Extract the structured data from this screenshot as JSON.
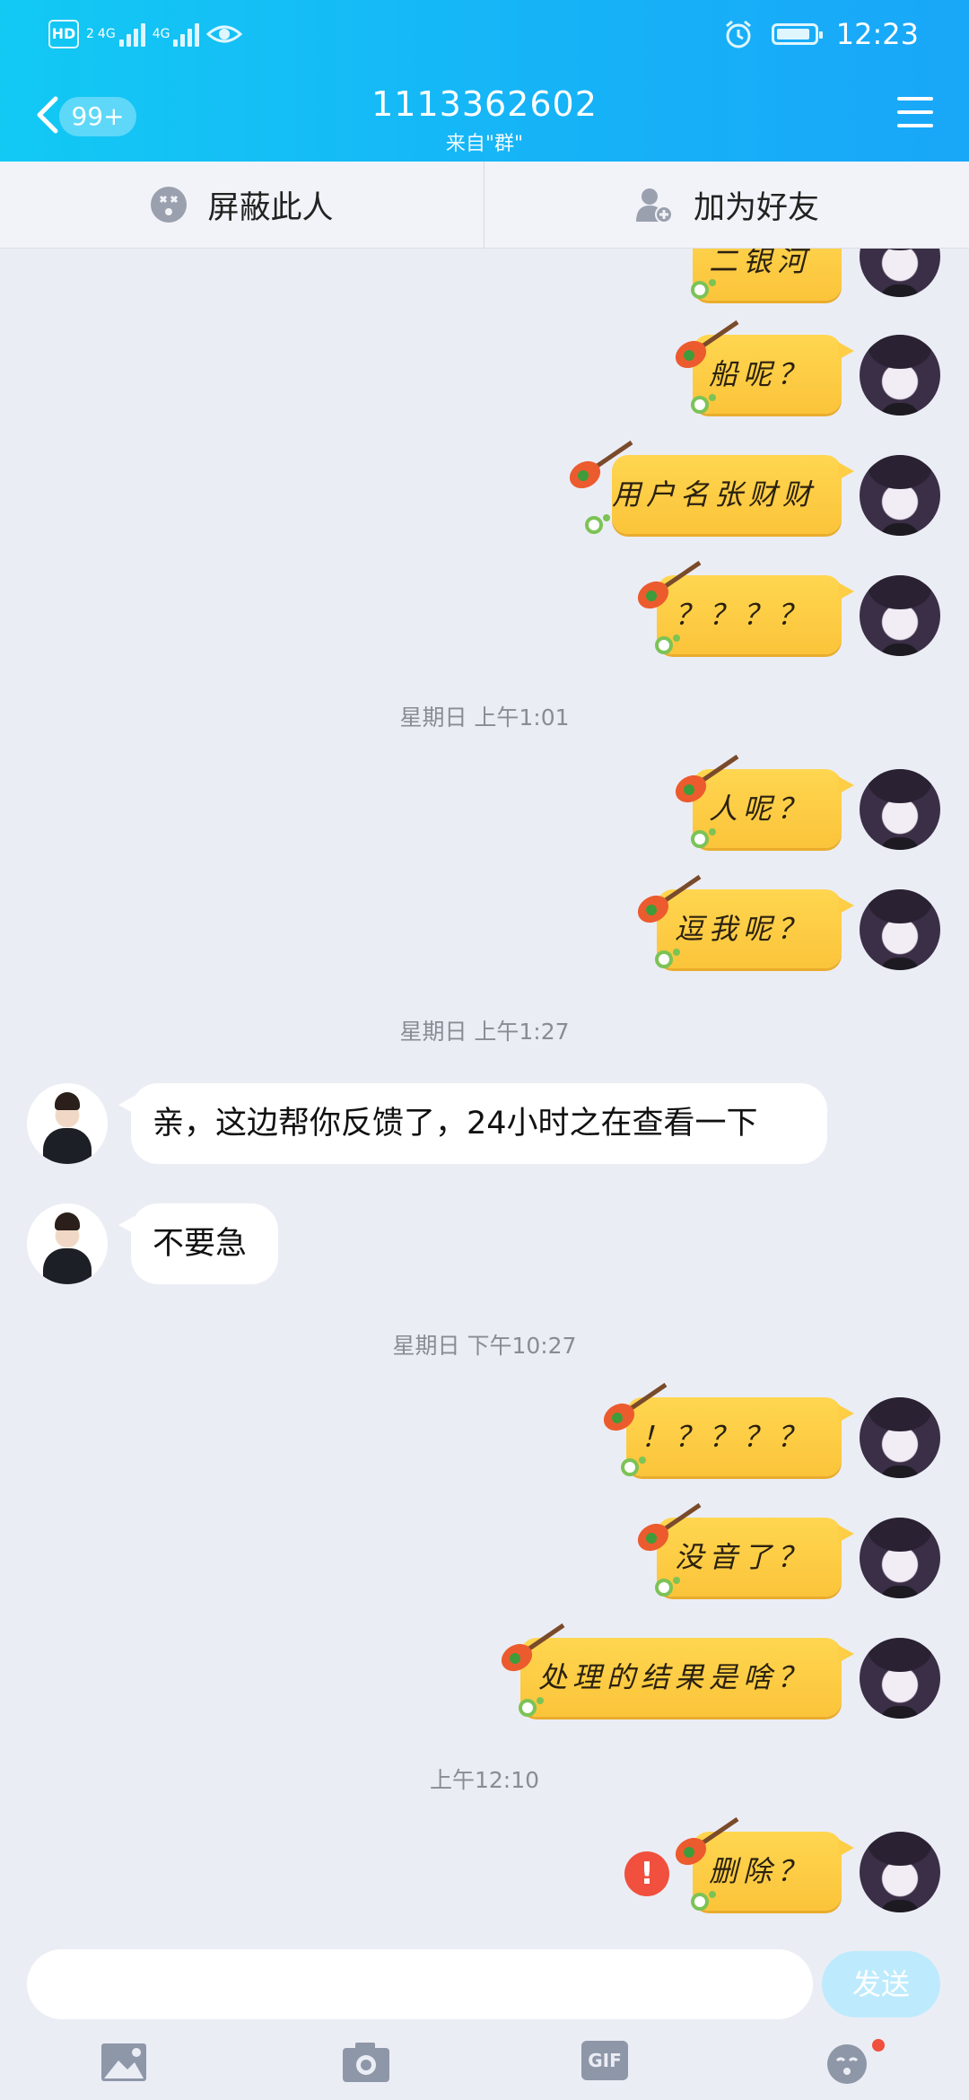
{
  "status_bar": {
    "hd_label": "HD",
    "sim_slot": "2",
    "network_1": "4G",
    "network_2": "4G",
    "time": "12:23"
  },
  "header": {
    "unread_count": "99+",
    "title": "1113362602",
    "subtitle": "来自\"群\""
  },
  "actions": {
    "block_label": "屏蔽此人",
    "add_friend_label": "加为好友"
  },
  "messages": [
    {
      "side": "me",
      "text": "二银河"
    },
    {
      "side": "me",
      "text": "船呢？"
    },
    {
      "side": "me",
      "text": "用户名张财财"
    },
    {
      "side": "me",
      "text": "？？？？"
    },
    {
      "side": "time",
      "text": "星期日 上午1:01"
    },
    {
      "side": "me",
      "text": "人呢？"
    },
    {
      "side": "me",
      "text": "逗我呢？"
    },
    {
      "side": "time",
      "text": "星期日 上午1:27"
    },
    {
      "side": "them",
      "text": "亲，这边帮你反馈了，24小时之在查看一下"
    },
    {
      "side": "them",
      "text": "不要急"
    },
    {
      "side": "time",
      "text": "星期日 下午10:27"
    },
    {
      "side": "me",
      "text": "！？？？？"
    },
    {
      "side": "me",
      "text": "没音了？"
    },
    {
      "side": "me",
      "text": "处理的结果是啥？"
    },
    {
      "side": "time",
      "text": "上午12:10"
    },
    {
      "side": "me",
      "text": "删除？",
      "failed": true
    }
  ],
  "composer": {
    "input_value": "",
    "send_label": "发送",
    "gif_label": "GIF"
  },
  "colors": {
    "header_start": "#12C9F4",
    "header_end": "#19A7F8",
    "bubble_me": "#FDCE46",
    "error": "#F0503D",
    "send_disabled": "#BDEBFD"
  }
}
